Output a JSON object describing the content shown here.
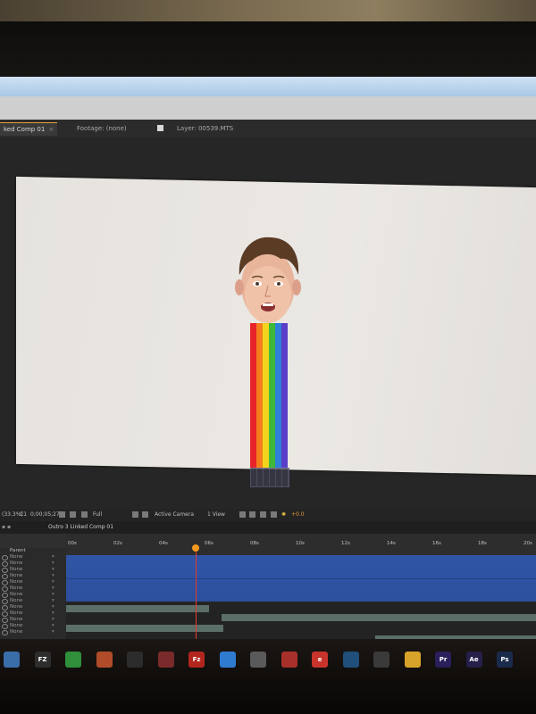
{
  "panel_tabs": {
    "composition_tab": "ked Comp 01",
    "footage_tab": "Footage: (none)",
    "layer_tab": "Layer: 00539.MTS"
  },
  "viewer_controls": {
    "zoom": "(33.3%)",
    "channel": "C1",
    "timecode": "0;00;05;27",
    "resolution": "Full",
    "camera": "Active Camera",
    "views": "1 View",
    "exposure": "+0.0"
  },
  "timeline": {
    "comp_name": "Outro 3 Linked Comp 01",
    "column_header": "Parent",
    "parent_rows": [
      "None",
      "None",
      "None",
      "None",
      "None",
      "None",
      "None",
      "None",
      "None",
      "None",
      "None",
      "None",
      "None"
    ],
    "ruler_labels": [
      "00s",
      "02s",
      "04s",
      "06s",
      "08s",
      "10s",
      "12s",
      "14s",
      "16s",
      "18s",
      "20s"
    ]
  },
  "rainbow_colors": [
    "#e8242b",
    "#f57d1e",
    "#f2d41c",
    "#3fb83a",
    "#2f7ed8",
    "#5a3ec8"
  ],
  "taskbar_icons": [
    {
      "name": "folder-icon",
      "label": ""
    },
    {
      "name": "recorder-icon",
      "label": "FZ"
    },
    {
      "name": "camtasia-icon",
      "label": ""
    },
    {
      "name": "archive-icon",
      "label": ""
    },
    {
      "name": "steam-icon",
      "label": ""
    },
    {
      "name": "record-icon",
      "label": ""
    },
    {
      "name": "filezilla-icon",
      "label": "Fz"
    },
    {
      "name": "dropbox-icon",
      "label": ""
    },
    {
      "name": "media-icon",
      "label": ""
    },
    {
      "name": "audio-icon",
      "label": ""
    },
    {
      "name": "ie-icon",
      "label": "e"
    },
    {
      "name": "network-icon",
      "label": ""
    },
    {
      "name": "play-icon",
      "label": ""
    },
    {
      "name": "chrome-icon",
      "label": ""
    },
    {
      "name": "premiere-icon",
      "label": "Pr"
    },
    {
      "name": "after-effects-icon",
      "label": "Ae"
    },
    {
      "name": "photoshop-icon",
      "label": "Ps"
    }
  ]
}
